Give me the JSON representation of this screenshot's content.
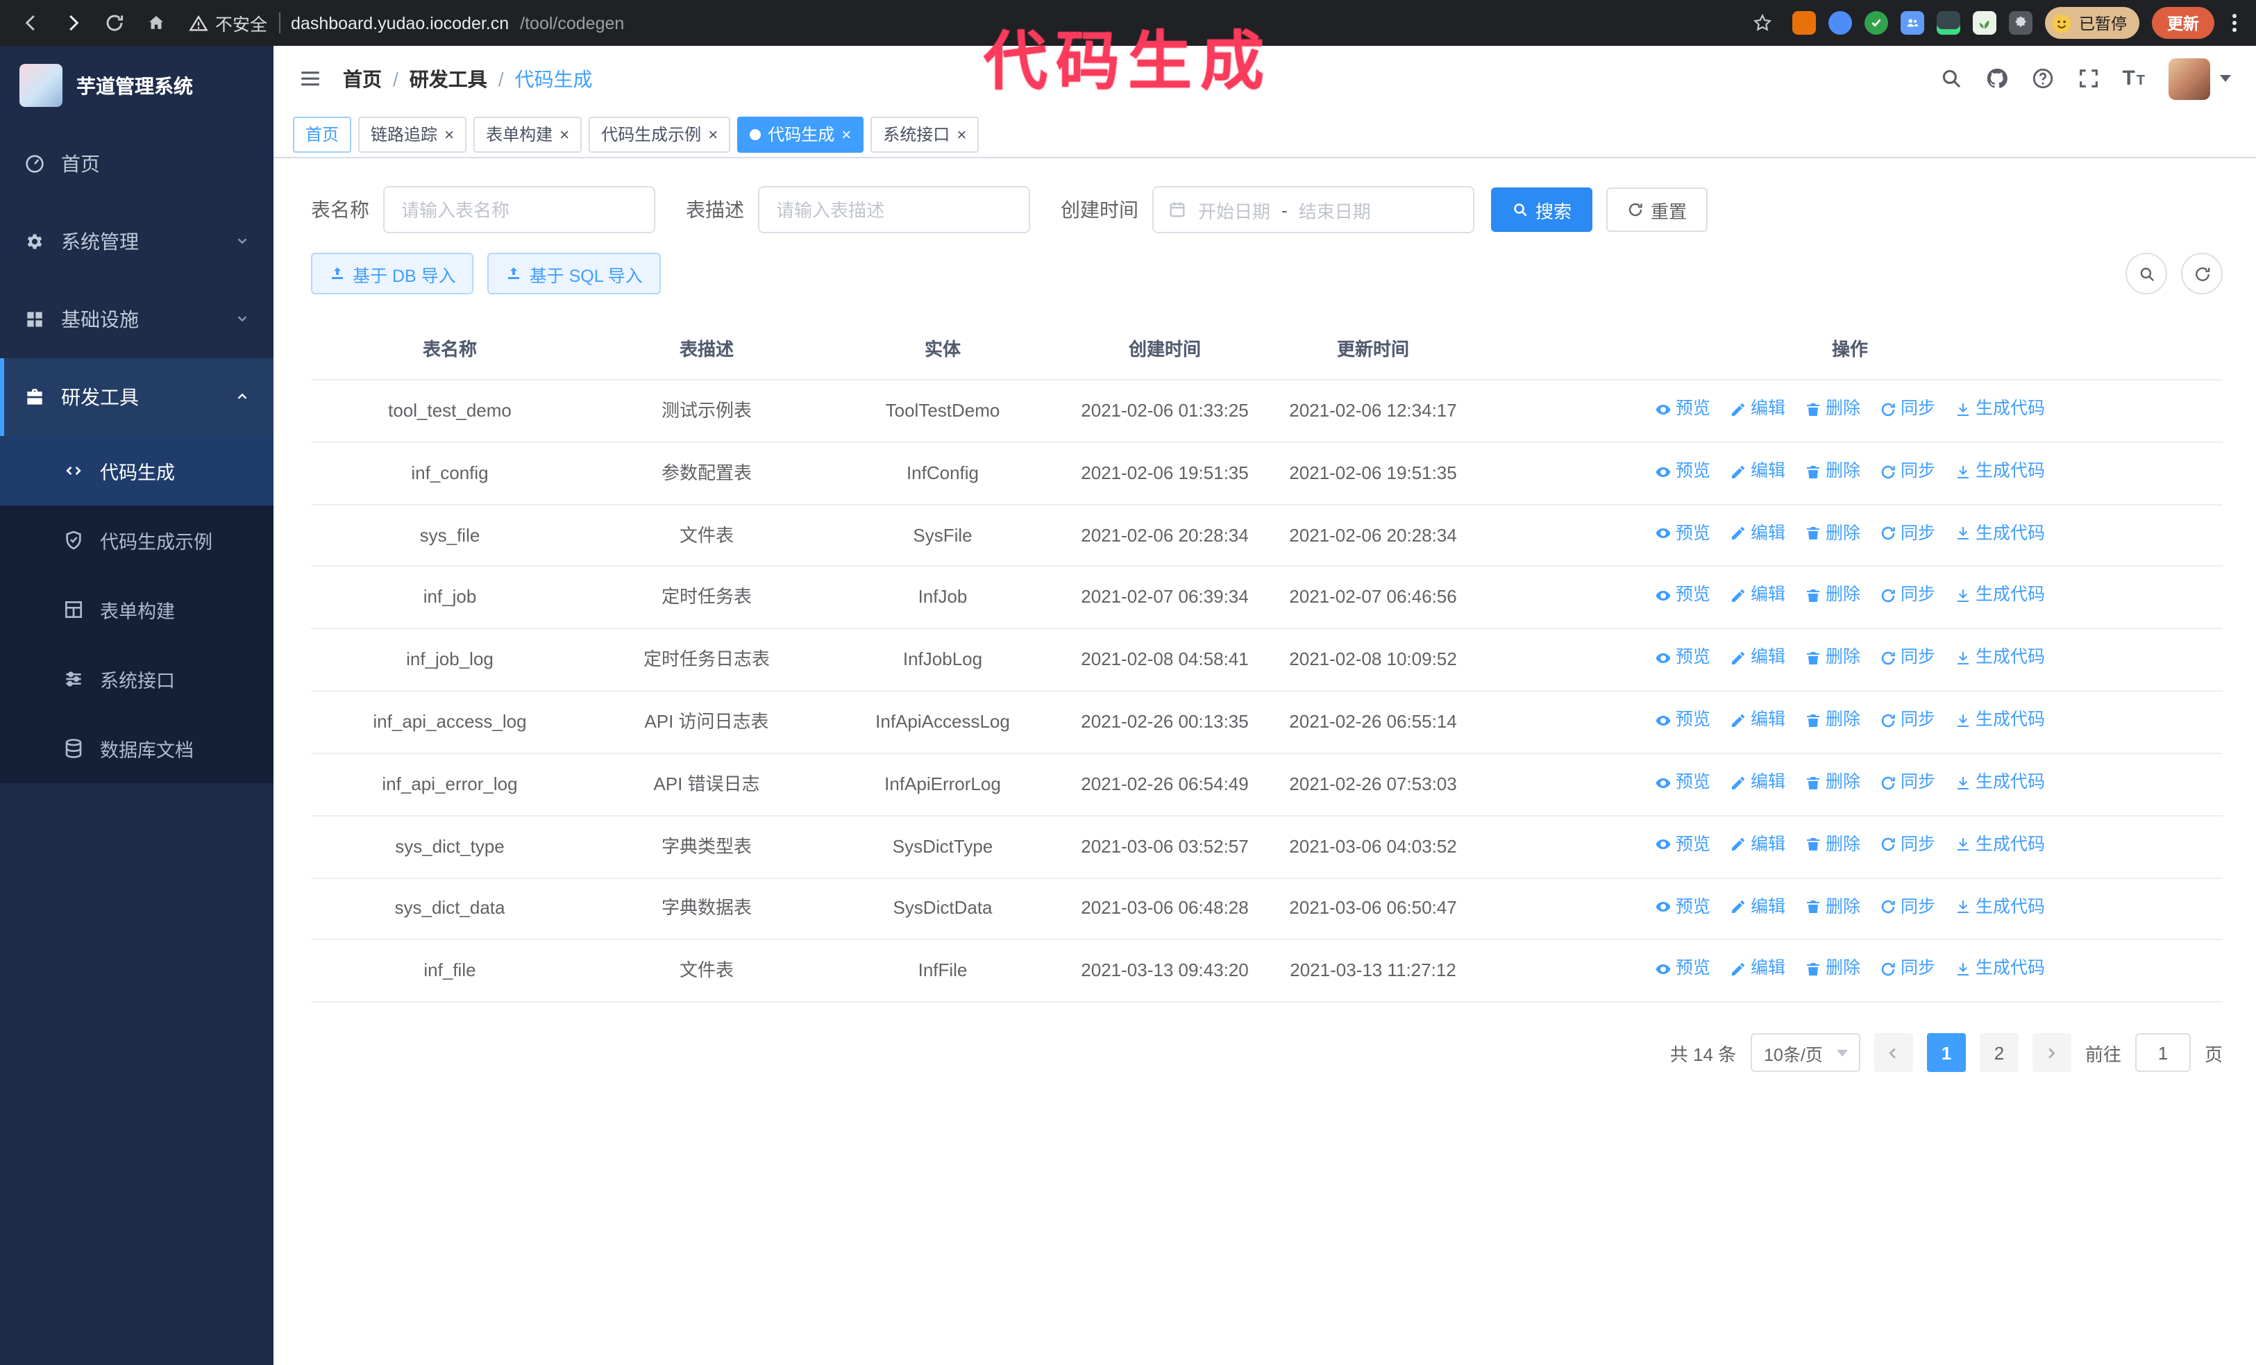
{
  "annotation": {
    "text": "代码生成"
  },
  "browser": {
    "security_label": "不安全",
    "url_host": "dashboard.yudao.iocoder.cn",
    "url_path": "/tool/codegen",
    "paused_label": "已暂停",
    "update_label": "更新"
  },
  "sidebar": {
    "logo_title": "芋道管理系统",
    "items": [
      {
        "label": "首页"
      },
      {
        "label": "系统管理"
      },
      {
        "label": "基础设施"
      },
      {
        "label": "研发工具"
      }
    ],
    "subitems": [
      {
        "label": "代码生成"
      },
      {
        "label": "代码生成示例"
      },
      {
        "label": "表单构建"
      },
      {
        "label": "系统接口"
      },
      {
        "label": "数据库文档"
      }
    ]
  },
  "header": {
    "separator": "/",
    "breadcrumb": [
      {
        "label": "首页"
      },
      {
        "label": "研发工具"
      },
      {
        "label": "代码生成"
      }
    ]
  },
  "tabs": [
    {
      "label": "首页"
    },
    {
      "label": "链路追踪"
    },
    {
      "label": "表单构建"
    },
    {
      "label": "代码生成示例"
    },
    {
      "label": "代码生成"
    },
    {
      "label": "系统接口"
    }
  ],
  "filters": {
    "table_name_label": "表名称",
    "table_name_placeholder": "请输入表名称",
    "table_desc_label": "表描述",
    "table_desc_placeholder": "请输入表描述",
    "create_time_label": "创建时间",
    "start_placeholder": "开始日期",
    "range_separator": "-",
    "end_placeholder": "结束日期",
    "search_label": "搜索",
    "reset_label": "重置"
  },
  "toolbar": {
    "import_db_label": "基于 DB 导入",
    "import_sql_label": "基于 SQL 导入"
  },
  "table": {
    "columns": [
      "表名称",
      "表描述",
      "实体",
      "创建时间",
      "更新时间",
      "操作"
    ],
    "row_actions": [
      {
        "label": "预览",
        "icon": "eye"
      },
      {
        "label": "编辑",
        "icon": "edit"
      },
      {
        "label": "删除",
        "icon": "delete"
      },
      {
        "label": "同步",
        "icon": "sync"
      },
      {
        "label": "生成代码",
        "icon": "generate"
      }
    ],
    "rows": [
      {
        "name": "tool_test_demo",
        "desc": "测试示例表",
        "entity": "ToolTestDemo",
        "created": "2021-02-06 01:33:25",
        "updated": "2021-02-06 12:34:17"
      },
      {
        "name": "inf_config",
        "desc": "参数配置表",
        "entity": "InfConfig",
        "created": "2021-02-06 19:51:35",
        "updated": "2021-02-06 19:51:35"
      },
      {
        "name": "sys_file",
        "desc": "文件表",
        "entity": "SysFile",
        "created": "2021-02-06 20:28:34",
        "updated": "2021-02-06 20:28:34"
      },
      {
        "name": "inf_job",
        "desc": "定时任务表",
        "entity": "InfJob",
        "created": "2021-02-07 06:39:34",
        "updated": "2021-02-07 06:46:56"
      },
      {
        "name": "inf_job_log",
        "desc": "定时任务日志表",
        "entity": "InfJobLog",
        "created": "2021-02-08 04:58:41",
        "updated": "2021-02-08 10:09:52"
      },
      {
        "name": "inf_api_access_log",
        "desc": "API 访问日志表",
        "entity": "InfApiAccessLog",
        "created": "2021-02-26 00:13:35",
        "updated": "2021-02-26 06:55:14"
      },
      {
        "name": "inf_api_error_log",
        "desc": "API 错误日志",
        "entity": "InfApiErrorLog",
        "created": "2021-02-26 06:54:49",
        "updated": "2021-02-26 07:53:03"
      },
      {
        "name": "sys_dict_type",
        "desc": "字典类型表",
        "entity": "SysDictType",
        "created": "2021-03-06 03:52:57",
        "updated": "2021-03-06 04:03:52"
      },
      {
        "name": "sys_dict_data",
        "desc": "字典数据表",
        "entity": "SysDictData",
        "created": "2021-03-06 06:48:28",
        "updated": "2021-03-06 06:50:47"
      },
      {
        "name": "inf_file",
        "desc": "文件表",
        "entity": "InfFile",
        "created": "2021-03-13 09:43:20",
        "updated": "2021-03-13 11:27:12"
      }
    ]
  },
  "pagination": {
    "total_label": "共 14 条",
    "page_size_label": "10条/页",
    "pages": [
      "1",
      "2"
    ],
    "goto_label": "前往",
    "goto_value": "1",
    "goto_suffix": "页"
  },
  "colors": {
    "accent": "#409eff",
    "sidebar_bg": "#1e2c4a",
    "annotation": "#fb3b5c"
  }
}
